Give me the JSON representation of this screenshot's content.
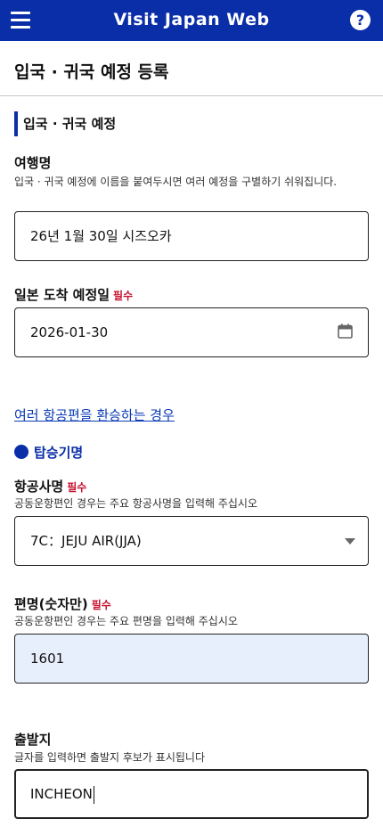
{
  "header": {
    "title": "Visit Japan Web",
    "help_label": "?"
  },
  "page": {
    "title": "입국 · 귀국 예정 등록"
  },
  "section": {
    "title": "입국 · 귀국 예정"
  },
  "trip_name": {
    "label": "여행명",
    "help": "입국 · 귀국 예정에 이름을 붙여두시면 여러 예정을 구별하기 쉬워집니다.",
    "value": "26년 1월 30일 시즈오카"
  },
  "arrival_date": {
    "label": "일본 도착 예정일",
    "required": "필수",
    "value": "2026-01-30"
  },
  "multi_flight_link": "여러 항공편을 환승하는 경우",
  "flight": {
    "title": "탑승기명",
    "airline": {
      "label": "항공사명",
      "required": "필수",
      "help": "공동운항편인 경우는 주요 항공사명을 입력해 주십시오",
      "value": "7C：JEJU AIR(JJA)"
    },
    "flight_number": {
      "label": "편명(숫자만)",
      "required": "필수",
      "help": "공동운항편인 경우는 주요 편명을 입력해 주십시오",
      "value": "1601"
    },
    "departure": {
      "label": "출발지",
      "help": "글자를 입력하면 출발지 후보가 표시됩니다",
      "value": "INCHEON"
    }
  },
  "colors": {
    "brand": "#0a2ea8",
    "required": "#c8102e",
    "link": "#0a3bb5",
    "filled_field": "#e8effc"
  },
  "icons": [
    "hamburger-menu-icon",
    "help-icon",
    "calendar-icon",
    "dropdown-caret-icon",
    "bullet-dot-icon"
  ]
}
